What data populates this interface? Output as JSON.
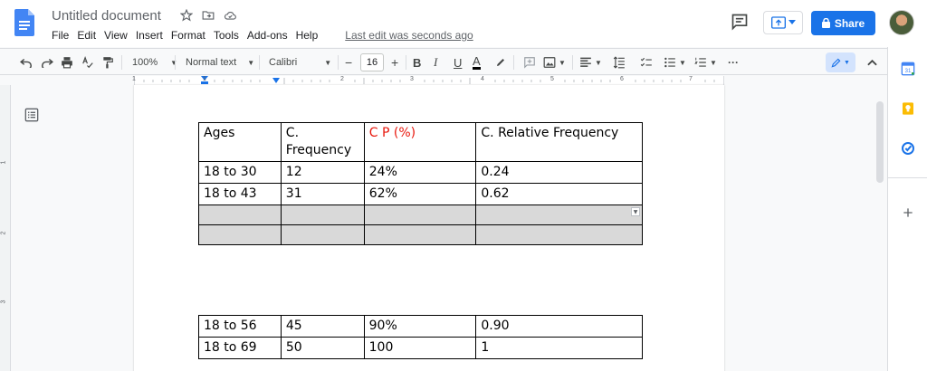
{
  "header": {
    "title": "Untitled document",
    "menu": [
      "File",
      "Edit",
      "View",
      "Insert",
      "Format",
      "Tools",
      "Add-ons",
      "Help"
    ],
    "last_edit": "Last edit was seconds ago",
    "share_label": "Share",
    "icons": [
      "docs-logo-icon",
      "star-icon",
      "move-folder-icon",
      "cloud-saved-icon",
      "comment-icon",
      "present-icon",
      "lock-icon",
      "avatar"
    ]
  },
  "toolbar": {
    "zoom": "100%",
    "style": "Normal text",
    "font": "Calibri",
    "font_size": "16",
    "bold": "B",
    "italic": "I",
    "underline": "U",
    "text_color": "A",
    "icons": [
      "undo-icon",
      "redo-icon",
      "print-icon",
      "spellcheck-icon",
      "paint-format-icon",
      "highlight-icon",
      "comment-add-icon",
      "image-icon",
      "align-icon",
      "line-spacing-icon",
      "checklist-icon",
      "bulleted-list-icon",
      "numbered-list-icon",
      "more-icon",
      "edit-mode-icon",
      "collapse-icon"
    ]
  },
  "ruler": {
    "numbers": [
      "1",
      "1",
      "2",
      "3",
      "4",
      "5",
      "6",
      "7"
    ]
  },
  "vruler": {
    "numbers": [
      "1",
      "2",
      "3"
    ]
  },
  "table1": {
    "header": [
      "Ages",
      "C.\nFrequency",
      "C P (%)",
      "C. Relative Frequency"
    ],
    "rows": [
      [
        "18 to 30",
        "12",
        "24%",
        "0.24"
      ],
      [
        "18 to 43",
        "31",
        "62%",
        "0.62"
      ]
    ]
  },
  "table2": {
    "rows": [
      [
        "18 to 56",
        "45",
        "90%",
        "0.90"
      ],
      [
        "18 to 69",
        "50",
        "100",
        "1"
      ]
    ]
  },
  "colors": {
    "accent": "#1a73e8",
    "header_red": "#e8170c",
    "empty_row_fill": "#d9d9d9"
  }
}
